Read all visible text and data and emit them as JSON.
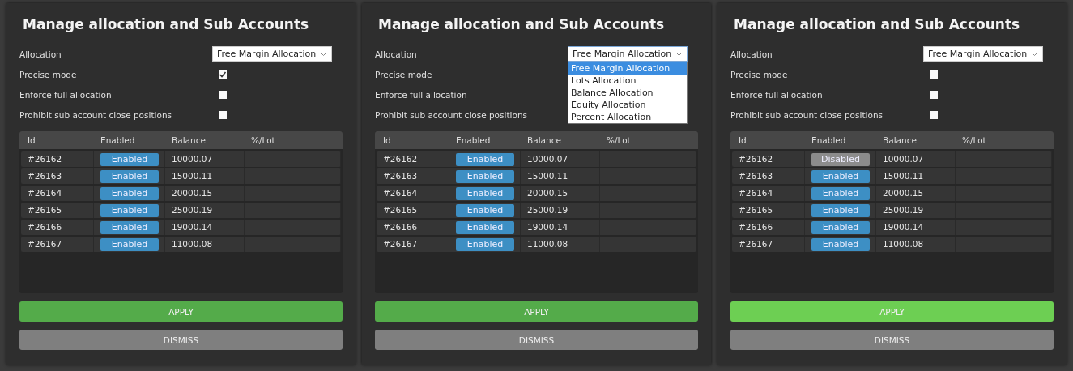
{
  "panels": [
    {
      "title": "Manage allocation and Sub Accounts",
      "allocation": {
        "label": "Allocation",
        "value": "Free Margin Allocation",
        "expanded": false
      },
      "options": [
        {
          "label": "Precise mode",
          "checked": true
        },
        {
          "label": "Enforce full allocation",
          "checked": false
        },
        {
          "label": "Prohibit sub account close positions",
          "checked": false
        }
      ],
      "columns": [
        "Id",
        "Enabled",
        "Balance",
        "%/Lot"
      ],
      "rows": [
        {
          "id": "#26162",
          "status": "Enabled",
          "enabled": true,
          "balance": "10000.07"
        },
        {
          "id": "#26163",
          "status": "Enabled",
          "enabled": true,
          "balance": "15000.11"
        },
        {
          "id": "#26164",
          "status": "Enabled",
          "enabled": true,
          "balance": "20000.15"
        },
        {
          "id": "#26165",
          "status": "Enabled",
          "enabled": true,
          "balance": "25000.19"
        },
        {
          "id": "#26166",
          "status": "Enabled",
          "enabled": true,
          "balance": "19000.14"
        },
        {
          "id": "#26167",
          "status": "Enabled",
          "enabled": true,
          "balance": "11000.08"
        }
      ],
      "apply": {
        "label": "APPLY",
        "hovered": false
      },
      "dismiss": "DISMISS"
    },
    {
      "title": "Manage allocation and Sub Accounts",
      "allocation": {
        "label": "Allocation",
        "value": "Free Margin Allocation",
        "expanded": true,
        "choices": [
          {
            "label": "Free Margin Allocation",
            "selected": true
          },
          {
            "label": "Lots Allocation",
            "selected": false
          },
          {
            "label": "Balance Allocation",
            "selected": false
          },
          {
            "label": "Equity Allocation",
            "selected": false
          },
          {
            "label": "Percent Allocation",
            "selected": false
          }
        ]
      },
      "options": [
        {
          "label": "Precise mode"
        },
        {
          "label": "Enforce full allocation"
        },
        {
          "label": "Prohibit sub account close positions"
        }
      ],
      "columns": [
        "Id",
        "Enabled",
        "Balance",
        "%/Lot"
      ],
      "rows": [
        {
          "id": "#26162",
          "status": "Enabled",
          "enabled": true,
          "balance": "10000.07"
        },
        {
          "id": "#26163",
          "status": "Enabled",
          "enabled": true,
          "balance": "15000.11"
        },
        {
          "id": "#26164",
          "status": "Enabled",
          "enabled": true,
          "balance": "20000.15"
        },
        {
          "id": "#26165",
          "status": "Enabled",
          "enabled": true,
          "balance": "25000.19"
        },
        {
          "id": "#26166",
          "status": "Enabled",
          "enabled": true,
          "balance": "19000.14"
        },
        {
          "id": "#26167",
          "status": "Enabled",
          "enabled": true,
          "balance": "11000.08"
        }
      ],
      "apply": {
        "label": "APPLY",
        "hovered": false
      },
      "dismiss": "DISMISS"
    },
    {
      "title": "Manage allocation and Sub Accounts",
      "allocation": {
        "label": "Allocation",
        "value": "Free Margin Allocation",
        "expanded": false
      },
      "options": [
        {
          "label": "Precise mode",
          "checked": false
        },
        {
          "label": "Enforce full allocation",
          "checked": false
        },
        {
          "label": "Prohibit sub account close positions",
          "checked": false
        }
      ],
      "columns": [
        "Id",
        "Enabled",
        "Balance",
        "%/Lot"
      ],
      "rows": [
        {
          "id": "#26162",
          "status": "Disabled",
          "enabled": false,
          "balance": "10000.07"
        },
        {
          "id": "#26163",
          "status": "Enabled",
          "enabled": true,
          "balance": "15000.11"
        },
        {
          "id": "#26164",
          "status": "Enabled",
          "enabled": true,
          "balance": "20000.15"
        },
        {
          "id": "#26165",
          "status": "Enabled",
          "enabled": true,
          "balance": "25000.19"
        },
        {
          "id": "#26166",
          "status": "Enabled",
          "enabled": true,
          "balance": "19000.14"
        },
        {
          "id": "#26167",
          "status": "Enabled",
          "enabled": true,
          "balance": "11000.08"
        }
      ],
      "apply": {
        "label": "APPLY",
        "hovered": true
      },
      "dismiss": "DISMISS"
    }
  ]
}
